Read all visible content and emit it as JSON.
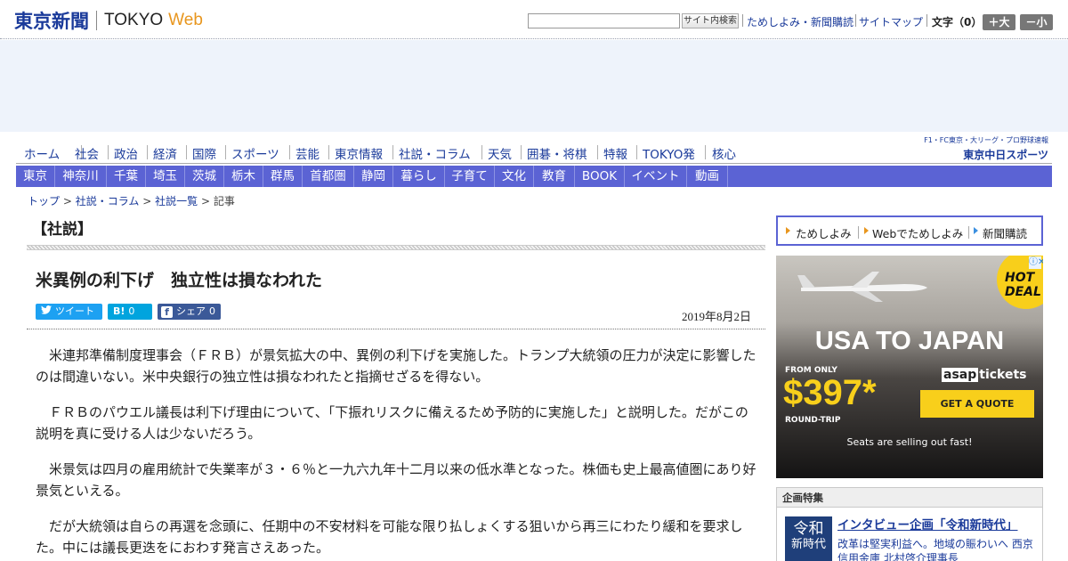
{
  "header": {
    "logo_jp": "東京新聞",
    "logo_tokyo": "TOKYO",
    "logo_web": "Web",
    "search_placeholder": "",
    "search_button": "サイト内検索",
    "links": [
      "ためしよみ・新聞購読",
      "サイトマップ"
    ],
    "font_size_label": "文字（0）",
    "font_larger": "＋大",
    "font_smaller": "－小"
  },
  "nav_primary": [
    "ホーム",
    "社会",
    "政治",
    "経済",
    "国際",
    "スポーツ",
    "芸能",
    "東京情報",
    "社説・コラム",
    "天気",
    "囲碁・将棋",
    "特報",
    "TOKYO発",
    "核心"
  ],
  "chunichi": {
    "tagline": "F1・FC東京・大リーグ・プロ野球速報",
    "name": "東京中日スポーツ"
  },
  "nav_secondary": [
    "東京",
    "神奈川",
    "千葉",
    "埼玉",
    "茨城",
    "栃木",
    "群馬",
    "首都圏",
    "静岡",
    "暮らし",
    "子育て",
    "文化",
    "教育",
    "BOOK",
    "イベント",
    "動画"
  ],
  "breadcrumb": {
    "items": [
      "トップ",
      "社説・コラム",
      "社説一覧"
    ],
    "current": "記事",
    "sep": ">"
  },
  "article": {
    "section": "【社説】",
    "title": "米異例の利下げ　独立性は損なわれた",
    "share": {
      "tweet": "ツイート",
      "hatena_icon": "B!",
      "hatena_count": "0",
      "facebook_icon": "f",
      "facebook_label": "シェア",
      "facebook_count": "0"
    },
    "date": "2019年8月2日",
    "paragraphs": [
      "米連邦準備制度理事会（ＦＲＢ）が景気拡大の中、異例の利下げを実施した。トランプ大統領の圧力が決定に影響したのは間違いない。米中央銀行の独立性は損なわれたと指摘せざるを得ない。",
      "ＦＲＢのパウエル議長は利下げ理由について、「下振れリスクに備えるため予防的に実施した」と説明した。だがこの説明を真に受ける人は少ないだろう。",
      "米景気は四月の雇用統計で失業率が３・６％と一九六九年十二月以来の低水準となった。株価も史上最高値圏にあり好景気といえる。",
      "だが大統領は自らの再選を念頭に、任期中の不安材料を可能な限り払しょくする狙いから再三にわたり緩和を要求した。中には議長更迭をにおわす発言さえあった。"
    ]
  },
  "sidebar": {
    "links": [
      "ためしよみ",
      "Webでためしよみ",
      "新聞購読"
    ],
    "link_colors": [
      "#e8961e",
      "#e8961e",
      "#3b8fe0"
    ],
    "ad": {
      "deal": "HOT DEAL",
      "adchoice": "ⓘ✕",
      "headline": "USA TO JAPAN",
      "from_only": "FROM ONLY",
      "price": "$397*",
      "round_trip": "ROUND-TRIP",
      "brand_box": "asap",
      "brand_rest": "tickets",
      "cta": "GET A QUOTE",
      "seats": "Seats are selling out fast!"
    },
    "feature": {
      "header": "企画特集",
      "thumb_line1": "令和",
      "thumb_line2": "新時代",
      "title": "インタビュー企画「令和新時代」",
      "desc": "改革は堅実利益へ。地域の賑わいへ 西京信用金庫 北村啓介理事長"
    }
  }
}
